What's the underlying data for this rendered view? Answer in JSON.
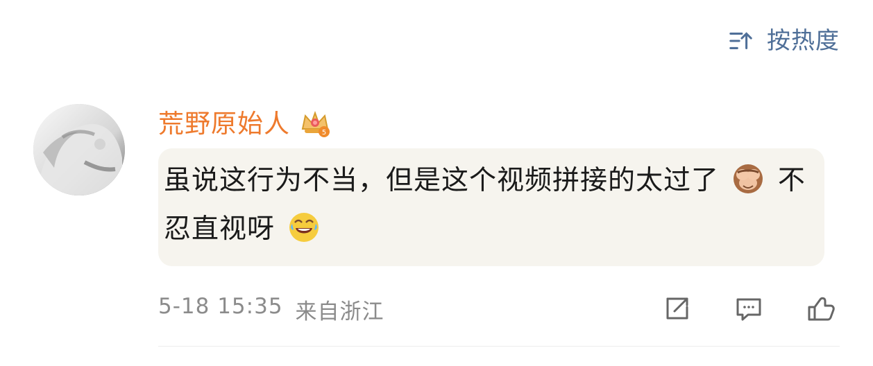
{
  "sort": {
    "label": "按热度",
    "icon": "sort-icon"
  },
  "comment": {
    "username": "荒野原始人",
    "badge_icon": "crown-level-5-icon",
    "text_part_1": "虽说这行为不当，但是这个视频拼接的太过了",
    "emoji_1": "see-no-evil-monkey-emoji",
    "text_part_2": "不忍直视呀",
    "emoji_2": "laughing-tears-emoji",
    "date": "5-18 15:35",
    "location": "来自浙江"
  },
  "actions": {
    "share_icon": "share-icon",
    "reply_icon": "comment-icon",
    "like_icon": "thumbs-up-icon"
  },
  "colors": {
    "username": "#ee7a2d",
    "sort": "#4f6f98",
    "meta": "#8b8b8b",
    "bubble": "#f6f4ee"
  }
}
